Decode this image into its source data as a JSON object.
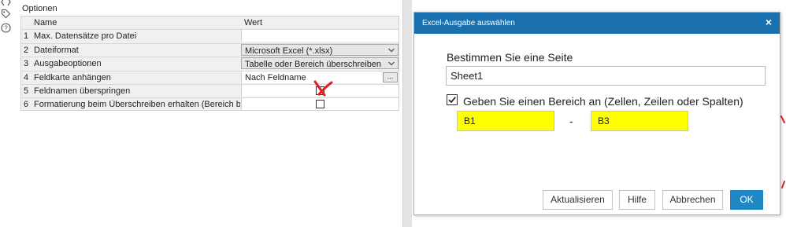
{
  "options_panel": {
    "title": "Optionen",
    "header": {
      "name": "Name",
      "value": "Wert"
    },
    "rows": [
      {
        "num": "1",
        "name": "Max. Datensätze pro Datei",
        "value": ""
      },
      {
        "num": "2",
        "name": "Dateiformat",
        "value": "Microsoft Excel (*.xlsx)"
      },
      {
        "num": "3",
        "name": "Ausgabeoptionen",
        "value": "Tabelle oder Bereich überschreiben"
      },
      {
        "num": "4",
        "name": "Feldkarte anhängen",
        "value": "Nach Feldname",
        "browse_label": "..."
      },
      {
        "num": "5",
        "name": "Feldnamen überspringen",
        "checked": false
      },
      {
        "num": "6",
        "name": "Formatierung beim Überschreiben erhalten (Bereich benötigt)",
        "checked": false
      }
    ],
    "icons": [
      "config-icon",
      "tag-icon",
      "help-icon"
    ]
  },
  "dialog": {
    "title": "Excel-Ausgabe auswählen",
    "close_label": "×",
    "heading": "Bestimmen Sie eine Seite",
    "sheet_value": "Sheet1",
    "range_checked": true,
    "range_label": "Geben Sie einen Bereich an (Zellen, Zeilen oder Spalten)",
    "range_start": "B1",
    "range_separator": "-",
    "range_end": "B3",
    "buttons": {
      "refresh": "Aktualisieren",
      "help": "Hilfe",
      "cancel": "Abbrechen",
      "ok": "OK"
    }
  },
  "colors": {
    "titlebar": "#1a6fae",
    "ok_button": "#1e88c7",
    "range_highlight": "#ffff00",
    "annotation_red": "#e0201f"
  }
}
